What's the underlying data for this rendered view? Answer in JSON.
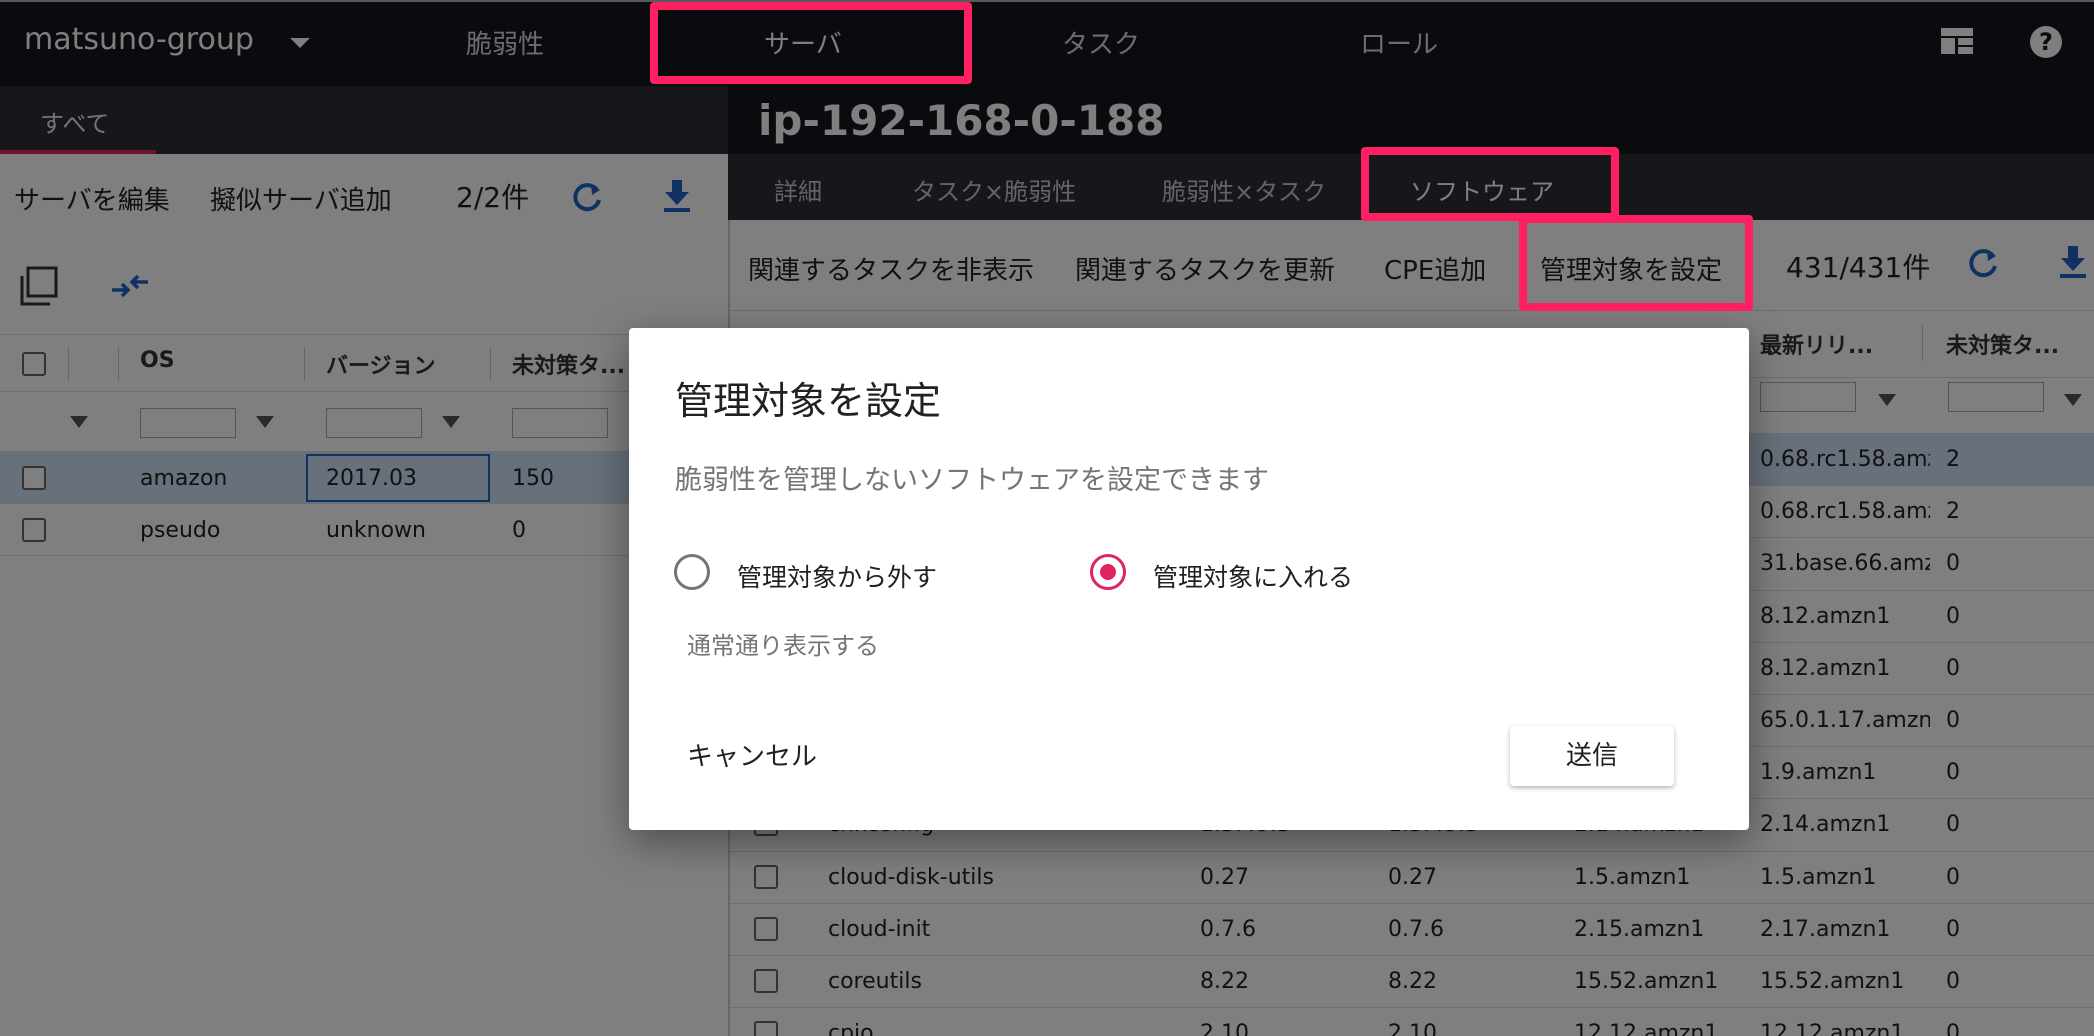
{
  "topbar": {
    "group": "matsuno-group",
    "nav": [
      "脆弱性",
      "サーバ",
      "タスク",
      "ロール"
    ],
    "layout_icon": "table-layout-icon",
    "help_icon": "help-circle-icon"
  },
  "left": {
    "tab": "すべて",
    "toolbar": {
      "edit": "サーバを編集",
      "add_pseudo": "擬似サーバ追加",
      "count": "2/2件"
    },
    "columns": [
      "OS",
      "バージョン",
      "未対策タ..."
    ],
    "rows": [
      {
        "os": "amazon",
        "version": "2017.03",
        "unresolved": "150"
      },
      {
        "os": "pseudo",
        "version": "unknown",
        "unresolved": "0"
      }
    ]
  },
  "right": {
    "server_title": "ip-192-168-0-188",
    "tabs": [
      "詳細",
      "タスク×脆弱性",
      "脆弱性×タスク",
      "ソフトウェア"
    ],
    "toolbar": {
      "hide_tasks": "関連するタスクを非表示",
      "update_tasks": "関連するタスクを更新",
      "add_cpe": "CPE追加",
      "set_managed": "管理対象を設定",
      "count": "431/431件"
    },
    "columns": {
      "latest_release": "最新リリ...",
      "unresolved": "未対策タ..."
    },
    "rows": [
      {
        "name": "",
        "c1": "",
        "c2": "",
        "c3": "",
        "release": "0.68.rc1.58.amz",
        "unresolved": "2"
      },
      {
        "name": "",
        "c1": "",
        "c2": "",
        "c3": "",
        "release": "0.68.rc1.58.amz",
        "unresolved": "2"
      },
      {
        "name": "",
        "c1": "",
        "c2": "",
        "c3": "",
        "release": "31.base.66.amz",
        "unresolved": "0"
      },
      {
        "name": "",
        "c1": "",
        "c2": "",
        "c3": "",
        "release": "8.12.amzn1",
        "unresolved": "0"
      },
      {
        "name": "",
        "c1": "",
        "c2": "",
        "c3": "",
        "release": "8.12.amzn1",
        "unresolved": "0"
      },
      {
        "name": "",
        "c1": "",
        "c2": "",
        "c3": "",
        "release": "65.0.1.17.amzn1",
        "unresolved": "0"
      },
      {
        "name": "",
        "c1": "",
        "c2": "",
        "c3": "",
        "release": "1.9.amzn1",
        "unresolved": "0"
      },
      {
        "name": "chkconfig",
        "c1": "1.3.49.3",
        "c2": "1.3.49.3",
        "c3": "2.14.amzn1",
        "release": "2.14.amzn1",
        "unresolved": "0"
      },
      {
        "name": "cloud-disk-utils",
        "c1": "0.27",
        "c2": "0.27",
        "c3": "1.5.amzn1",
        "release": "1.5.amzn1",
        "unresolved": "0"
      },
      {
        "name": "cloud-init",
        "c1": "0.7.6",
        "c2": "0.7.6",
        "c3": "2.15.amzn1",
        "release": "2.17.amzn1",
        "unresolved": "0"
      },
      {
        "name": "coreutils",
        "c1": "8.22",
        "c2": "8.22",
        "c3": "15.52.amzn1",
        "release": "15.52.amzn1",
        "unresolved": "0"
      },
      {
        "name": "cpio",
        "c1": "2.10",
        "c2": "2.10",
        "c3": "12.12.amzn1",
        "release": "12.12.amzn1",
        "unresolved": "0"
      }
    ]
  },
  "dialog": {
    "title": "管理対象を設定",
    "description": "脆弱性を管理しないソフトウェアを設定できます",
    "option_exclude": "管理対象から外す",
    "option_include": "管理対象に入れる",
    "selected": "include",
    "hint": "通常通り表示する",
    "cancel": "キャンセル",
    "submit": "送信"
  },
  "colors": {
    "accent": "#e0245e",
    "highlight": "#ff1f63",
    "icon_blue": "#1e63c8",
    "dark": "#13171d"
  }
}
